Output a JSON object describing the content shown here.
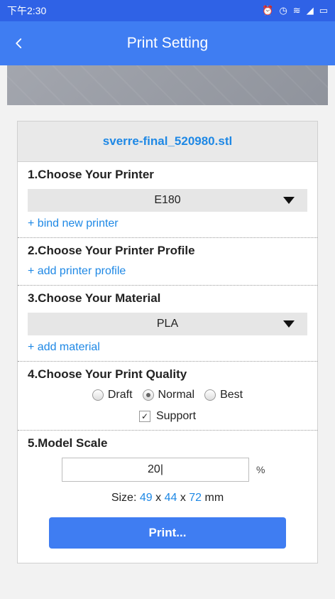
{
  "status_bar": {
    "time": "下午2:30",
    "icons": [
      "alarm-icon",
      "clock-icon",
      "wifi-icon",
      "signal-icon",
      "battery-icon"
    ]
  },
  "header": {
    "title": "Print Setting"
  },
  "file": {
    "name": "sverre-final_520980.stl"
  },
  "sections": {
    "printer": {
      "title": "1.Choose Your Printer",
      "selected": "E180",
      "link": "+ bind new printer"
    },
    "profile": {
      "title": "2.Choose Your Printer Profile",
      "link": "+ add printer profile"
    },
    "material": {
      "title": "3.Choose Your Material",
      "selected": "PLA",
      "link": "+ add material"
    },
    "quality": {
      "title": "4.Choose Your Print Quality",
      "options": [
        "Draft",
        "Normal",
        "Best"
      ],
      "selected": "Normal",
      "support_label": "Support",
      "support_checked": true
    },
    "scale": {
      "title": "5.Model Scale",
      "value": "20",
      "unit": "%",
      "size_prefix": "Size:",
      "size_x": "49",
      "size_y": "44",
      "size_z": "72",
      "size_unit": "mm",
      "times": "x"
    }
  },
  "actions": {
    "print_label": "Print..."
  },
  "colors": {
    "status_bar": "#2f62e6",
    "app_bar": "#3f7df2",
    "accent": "#1e88e5"
  }
}
